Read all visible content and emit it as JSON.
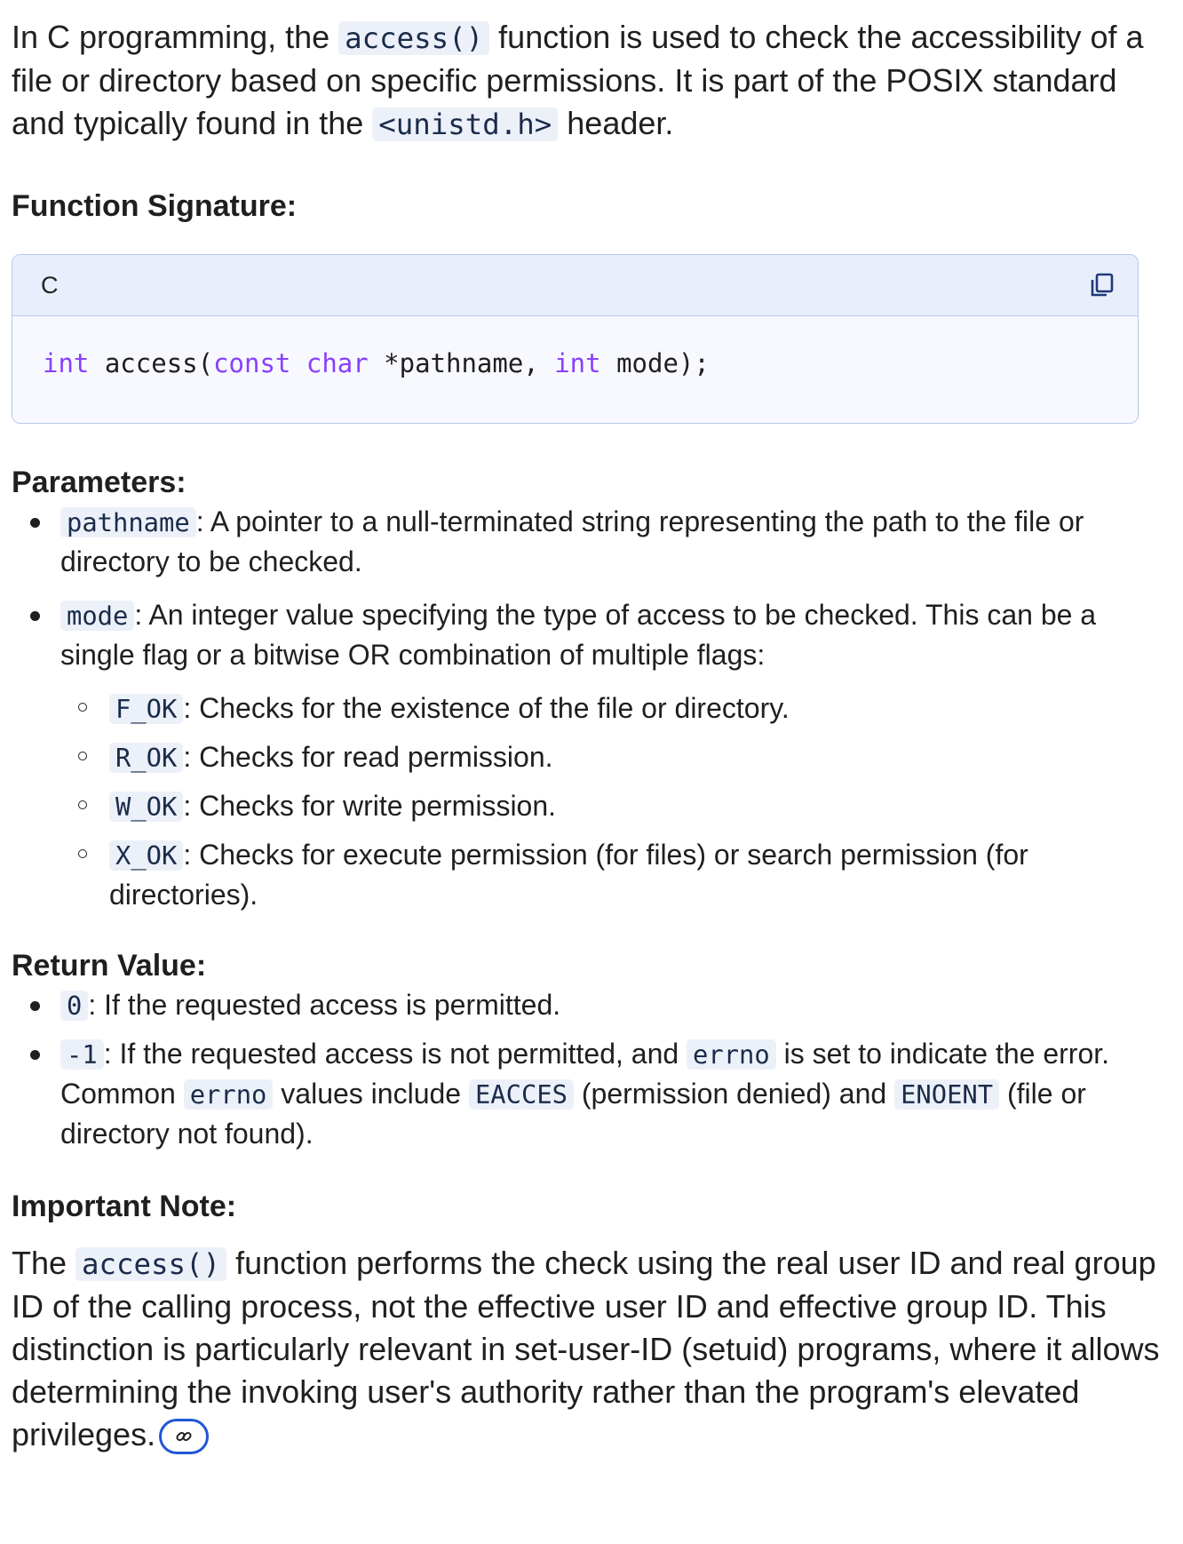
{
  "intro": {
    "t1": "In C programming, the ",
    "code1": "access()",
    "t2": " function is used to check the accessibility of a file or directory based on specific permissions. It is part of the POSIX standard and typically found in the ",
    "code2": "<unistd.h>",
    "t3": " header."
  },
  "signature": {
    "heading": "Function Signature:",
    "language": "C",
    "code": {
      "kw_int1": "int",
      "fn": " access(",
      "kw_const": "const",
      "sp1": " ",
      "kw_char": "char",
      "ptr": " *pathname, ",
      "kw_int2": "int",
      "rest": " mode);"
    },
    "copy_icon": "copy-icon"
  },
  "parameters": {
    "heading": "Parameters:",
    "pathname": {
      "code": "pathname",
      "text": ": A pointer to a null-terminated string representing the path to the file or directory to be checked."
    },
    "mode": {
      "code": "mode",
      "text": ": An integer value specifying the type of access to be checked. This can be a single flag or a bitwise OR combination of multiple flags:"
    },
    "flags": [
      {
        "code": "F_OK",
        "text": ": Checks for the existence of the file or directory."
      },
      {
        "code": "R_OK",
        "text": ": Checks for read permission."
      },
      {
        "code": "W_OK",
        "text": ": Checks for write permission."
      },
      {
        "code": "X_OK",
        "text": ": Checks for execute permission (for files) or search permission (for directories)."
      }
    ]
  },
  "return_value": {
    "heading": "Return Value:",
    "zero": {
      "code": "0",
      "text": ": If the requested access is permitted."
    },
    "neg": {
      "code": "-1",
      "t1": ": If the requested access is not permitted, and ",
      "c2": "errno",
      "t2": " is set to indicate the error. Common ",
      "c3": "errno",
      "t3": " values include ",
      "c4": "EACCES",
      "t4": " (permission denied) and ",
      "c5": "ENOENT",
      "t5": " (file or directory not found)."
    }
  },
  "note": {
    "heading": "Important Note:",
    "t1": "The ",
    "code": "access()",
    "t2": " function performs the check using the real user ID and real group ID of the calling process, not the effective user ID and effective group ID. This distinction is particularly relevant in set-user-ID (setuid) programs, where it allows determining the invoking user's authority rather than the program's elevated privileges.",
    "link_icon": "link-icon"
  }
}
